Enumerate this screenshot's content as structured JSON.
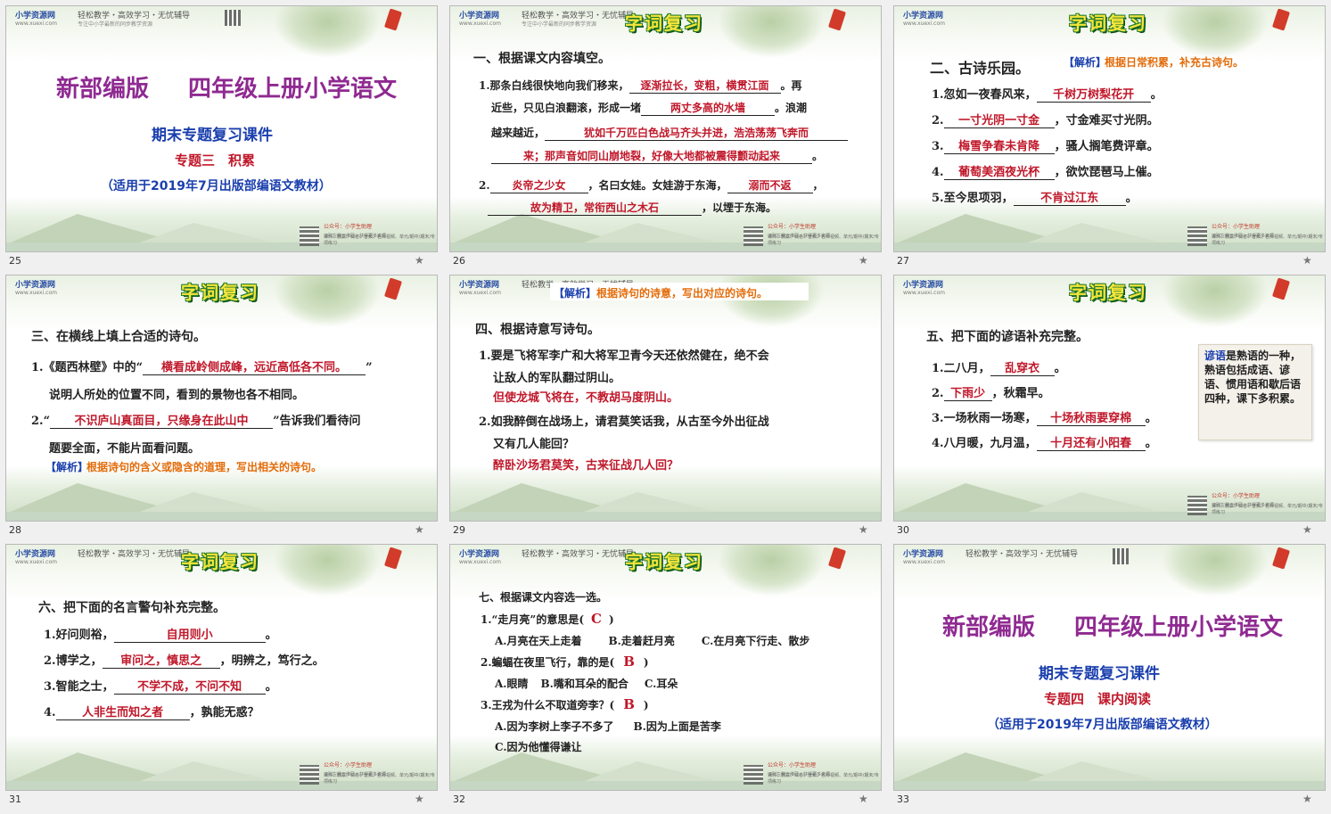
{
  "slides": [
    {
      "number": "25",
      "title_left": "新部编版",
      "title_right": "四年级上册小学语文",
      "subtitle": "期末专题复习课件",
      "topic": "专题三　积累",
      "note": "（适用于2019年7月出版部编语文教材）"
    },
    {
      "number": "26",
      "banner": "字词复习",
      "heading": "一、根据课文内容填空。",
      "q1_a": "1.那条白线很快地向我们移来，",
      "q1_ans1": "逐渐拉长，变粗，横贯江面",
      "q1_b": "。再",
      "q1_c": "近些，只见白浪翻滚，形成一堵",
      "q1_ans2": "两丈多高的水墙",
      "q1_d": "。浪潮",
      "q1_e": "越来越近，",
      "q1_ans3": "犹如千万匹白色战马齐头并进，浩浩荡荡飞奔而",
      "q1_ans4": "来；那声音如同山崩地裂，好像大地都被震得颤动起来",
      "q1_f": "。",
      "q2_a": "2.",
      "q2_ans1": "炎帝之少女",
      "q2_b": "，名曰女娃。女娃游于东海，",
      "q2_ans2": "溺而不返",
      "q2_c": "，",
      "q2_ans3": "故为精卫，常衔西山之木石",
      "q2_d": "，以堙于东海。"
    },
    {
      "number": "27",
      "banner": "字词复习",
      "heading": "二、古诗乐园。",
      "hint_tag": "【解析】",
      "hint_text": "根据日常积累，补充古诗句。",
      "l1_a": "1.忽如一夜春风来，",
      "l1_ans": "千树万树梨花开",
      "l1_b": "。",
      "l2_a": "2.",
      "l2_ans": "一寸光阴一寸金",
      "l2_b": "，寸金难买寸光阴。",
      "l3_a": "3.",
      "l3_ans": "梅雪争春未肯降",
      "l3_b": "，骚人搁笔费评章。",
      "l4_a": "4.",
      "l4_ans": "葡萄美酒夜光杯",
      "l4_b": "，欲饮琵琶马上催。",
      "l5_a": "5.至今思项羽，",
      "l5_ans": "不肯过江东",
      "l5_b": "。"
    },
    {
      "number": "28",
      "banner": "字词复习",
      "heading": "三、在横线上填上合适的诗句。",
      "q1_a": "1.《题西林壁》中的“",
      "q1_ans": "横看成岭侧成峰，远近高低各不同。",
      "q1_b": "”",
      "q1_c": "说明人所处的位置不同，看到的景物也各不相同。",
      "q2_a": "2.“",
      "q2_ans": "不识庐山真面目，只缘身在此山中",
      "q2_b": "”告诉我们看待问",
      "q2_c": "题要全面，不能片面看问题。",
      "hint_tag": "【解析】",
      "hint_text": "根据诗句的含义或隐含的道理，写出相关的诗句。"
    },
    {
      "number": "29",
      "hint_tag": "【解析】",
      "hint_text": "根据诗句的诗意，写出对应的诗句。",
      "heading": "四、根据诗意写诗句。",
      "q1_a": "1.要是飞将军李广和大将军卫青今天还依然健在，绝不会",
      "q1_b": "让敌人的军队翻过阴山。",
      "q1_ans": "但使龙城飞将在，不教胡马度阴山。",
      "q2_a": "2.如我醉倒在战场上，请君莫笑话我，从古至今外出征战",
      "q2_b": "又有几人能回？",
      "q2_ans": "醉卧沙场君莫笑，古来征战几人回？"
    },
    {
      "number": "30",
      "banner": "字词复习",
      "heading": "五、把下面的谚语补充完整。",
      "l1_a": "1.二八月，",
      "l1_ans": "乱穿衣",
      "l1_b": "。",
      "l2_a": "2.",
      "l2_ans": "下雨少",
      "l2_b": "，秋霜早。",
      "l3_a": "3.一场秋雨一场寒，",
      "l3_ans": "十场秋雨要穿棉",
      "l3_b": "。",
      "l4_a": "4.八月暖，九月温，",
      "l4_ans": "十月还有小阳春",
      "l4_b": "。",
      "note_term": "谚语",
      "note_text": "是熟语的一种，熟语包括成语、谚语、惯用语和歇后语四种，课下多积累。"
    },
    {
      "number": "31",
      "banner": "字词复习",
      "heading": "六、把下面的名言警句补充完整。",
      "l1_a": "1.好问则裕，",
      "l1_ans": "自用则小",
      "l1_b": "。",
      "l2_a": "2.博学之，",
      "l2_ans": "审问之，慎思之",
      "l2_b": "，明辨之，笃行之。",
      "l3_a": "3.智能之士，",
      "l3_ans": "不学不成，不问不知",
      "l3_b": "。",
      "l4_a": "4.",
      "l4_ans": "人非生而知之者",
      "l4_b": "，孰能无惑？"
    },
    {
      "number": "32",
      "banner": "字词复习",
      "heading": "七、根据课文内容选一选。",
      "q1": "1.“走月亮”的意思是(",
      "q1_ans": "C",
      "q1_end": ")",
      "q1_opts": [
        "A.月亮在天上走着",
        "B.走着赶月亮",
        "C.在月亮下行走、散步"
      ],
      "q2": "2.蝙蝠在夜里飞行，靠的是(",
      "q2_ans": "B",
      "q2_end": ")",
      "q2_opts": [
        "A.眼睛",
        "B.嘴和耳朵的配合",
        "C.耳朵"
      ],
      "q3": "3.王戎为什么不取道旁李？(",
      "q3_ans": "B",
      "q3_end": ")",
      "q3_opts": [
        "A.因为李树上李子不多了",
        "B.因为上面是苦李",
        "C.因为他懂得谦让"
      ]
    },
    {
      "number": "33",
      "title_left": "新部编版",
      "title_right": "四年级上册小学语文",
      "subtitle": "期末专题复习课件",
      "topic": "专题四　课内阅读",
      "note": "（适用于2019年7月出版部编语文教材）"
    }
  ],
  "header": {
    "brand": "小学资源网",
    "brand_url": "www.xuexi.com",
    "slogan": "轻松教学・高效学习・无忧辅导",
    "slogan_sub": "专注中小学最新的同步教学资源"
  },
  "footer": {
    "line1": "公众号：小学生助理",
    "line2": "识别左侧二维码，获得更多资源",
    "line3": "课件、教案、试卷、音频、名师视频、单元/期中/期末/专项练习"
  },
  "star_icon": "★"
}
